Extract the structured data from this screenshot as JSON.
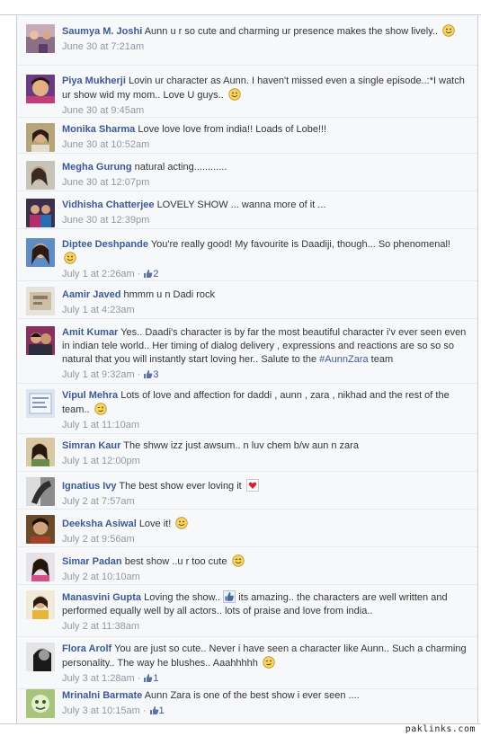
{
  "comments": [
    {
      "author": "Saumya M. Joshi",
      "text": "Aunn u r so cute and charming ur presence makes the show lively..",
      "time": "June 30 at 7:21am",
      "likes": null,
      "avatar": "av-1"
    },
    {
      "author": "Piya Mukherji",
      "text": "Lovin ur character as Aunn. I haven't missed even a single episode..:*I watch ur show wid my mom.. Love U guys..",
      "time": "June 30 at 9:45am",
      "likes": null,
      "avatar": "av-2"
    },
    {
      "author": "Monika Sharma",
      "text": "Love love love from india!! Loads of Lobe!!!",
      "time": "June 30 at 10:52am",
      "likes": null,
      "avatar": "av-3"
    },
    {
      "author": "Megha Gurung",
      "text": "natural acting............",
      "time": "June 30 at 12:07pm",
      "likes": null,
      "avatar": "av-4"
    },
    {
      "author": "Vidhisha Chatterjee",
      "text": "LOVELY SHOW ... wanna more of it ...",
      "time": "June 30 at 12:39pm",
      "likes": null,
      "avatar": "av-5"
    },
    {
      "author": "Diptee Deshpande",
      "text": "You're really good! My favourite is Daadiji, though... So phenomenal!",
      "time": "July 1 at 2:26am",
      "likes": "2",
      "avatar": "av-6"
    },
    {
      "author": "Aamir Javed",
      "text": "hmmm u n Dadi rock",
      "time": "July 1 at 4:23am",
      "likes": null,
      "avatar": "av-7"
    },
    {
      "author": "Amit Kumar",
      "text": "Yes.. Daadi's character is by far the most beautiful character i'v ever seen even in indian tele world.. Her timing of dialog delivery , expressions and reactions are so so so natural that you will instantly start loving her.. Salute to the",
      "hashtag": "#AunnZara",
      "text_after": "team",
      "time": "July 1 at 9:32am",
      "likes": "3",
      "avatar": "av-8"
    },
    {
      "author": "Vipul Mehra",
      "text": "Lots of love and affection for daddi , aunn , zara , nikhad and the rest of the team..",
      "time": "July 1 at 11:10am",
      "likes": null,
      "avatar": "av-9"
    },
    {
      "author": "Simran Kaur",
      "text": "The shww izz just awsum.. n luv chem b/w aun n zara",
      "time": "July 1 at 12:00pm",
      "likes": null,
      "avatar": "av-10"
    },
    {
      "author": "Ignatius Ivy",
      "text": "The best show ever loving it",
      "time": "July 2 at 7:57am",
      "likes": null,
      "avatar": "av-11"
    },
    {
      "author": "Deeksha Asiwal",
      "text": "Love it!",
      "time": "July 2 at 9:56am",
      "likes": null,
      "avatar": "av-12"
    },
    {
      "author": "Simar Padan",
      "text": "best show ..u r too cute",
      "time": "July 2 at 10:10am",
      "likes": null,
      "avatar": "av-13"
    },
    {
      "author": "Manasvini Gupta",
      "text": "Loving the show..",
      "text_after": "its amazing.. the characters are well written and performed equally well by all actors.. lots of praise and love from india..",
      "time": "July 2 at 11:38am",
      "likes": null,
      "avatar": "av-14"
    },
    {
      "author": "Flora Arolf",
      "text": "You are just so cute.. Never i have seen a character like Aunn.. Such a charming personality.. The way he blushes.. Aaahhhhh",
      "time": "July 3 at 1:28am",
      "likes": "1",
      "avatar": "av-15"
    },
    {
      "author": "Mrinalni Barmate",
      "text": "Aunn Zara is one of the best show i ever seen ....",
      "time": "July 3 at 10:15am",
      "likes": "1",
      "avatar": "av-16"
    }
  ],
  "separator": "·",
  "watermark": "paklinks.com",
  "colors": {
    "author": "#3b5998",
    "meta": "#9197a3",
    "background": "#f7f8fa",
    "text": "#333333"
  },
  "icons": {
    "like": "thumbs-up-icon",
    "smile": "smiley-icon",
    "heart": "heart-icon",
    "wink": "wink-icon"
  }
}
